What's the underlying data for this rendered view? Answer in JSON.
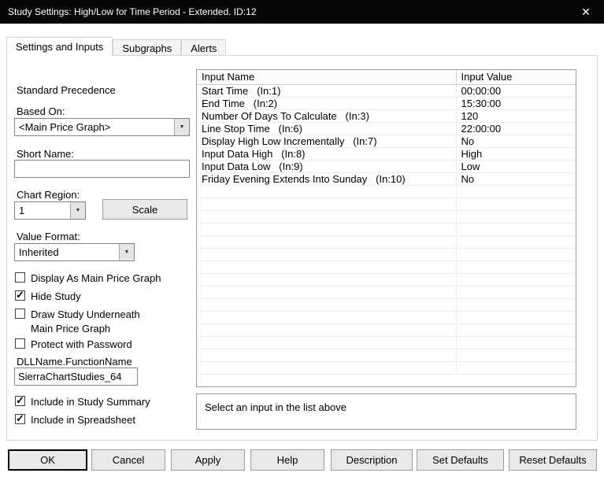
{
  "window": {
    "title": "Study Settings: High/Low for Time Period - Extended. ID:12",
    "close_glyph": "✕"
  },
  "tabs": [
    {
      "label": "Settings and Inputs",
      "active": true
    },
    {
      "label": "Subgraphs",
      "active": false
    },
    {
      "label": "Alerts",
      "active": false
    }
  ],
  "left_panel": {
    "precedence_label": "Standard Precedence",
    "based_on_label": "Based On:",
    "based_on_value": "<Main Price Graph>",
    "short_name_label": "Short Name:",
    "short_name_value": "",
    "chart_region_label": "Chart Region:",
    "chart_region_value": "1",
    "scale_button_label": "Scale",
    "value_format_label": "Value Format:",
    "value_format_value": "Inherited",
    "checkboxes": [
      {
        "label": "Display As Main Price Graph",
        "checked": false
      },
      {
        "label": "Hide Study",
        "checked": true
      },
      {
        "label": "Draw Study Underneath Main Price Graph",
        "checked": false
      },
      {
        "label": "Protect with Password",
        "checked": false
      }
    ],
    "dll_label": "DLLName.FunctionName",
    "dll_value": "SierraChartStudies_64",
    "include_summary": {
      "label": "Include in Study Summary",
      "checked": true
    },
    "include_spreadsheet": {
      "label": "Include in Spreadsheet",
      "checked": true
    }
  },
  "inputs_table": {
    "columns": [
      "Input Name",
      "Input Value"
    ],
    "rows": [
      {
        "name": "Start Time   (In:1)",
        "value": "00:00:00"
      },
      {
        "name": "End Time   (In:2)",
        "value": "15:30:00"
      },
      {
        "name": "Number Of Days To Calculate   (In:3)",
        "value": "120"
      },
      {
        "name": "Line Stop Time   (In:6)",
        "value": "22:00:00"
      },
      {
        "name": "Display High Low Incrementally   (In:7)",
        "value": "No"
      },
      {
        "name": "Input Data High   (In:8)",
        "value": "High"
      },
      {
        "name": "Input Data Low   (In:9)",
        "value": "Low"
      },
      {
        "name": "Friday Evening Extends Into Sunday   (In:10)",
        "value": "No"
      }
    ]
  },
  "hint_text": "Select an input in the list above",
  "buttons": [
    "OK",
    "Cancel",
    "Apply",
    "Help",
    "Description",
    "Set Defaults",
    "Reset Defaults"
  ]
}
